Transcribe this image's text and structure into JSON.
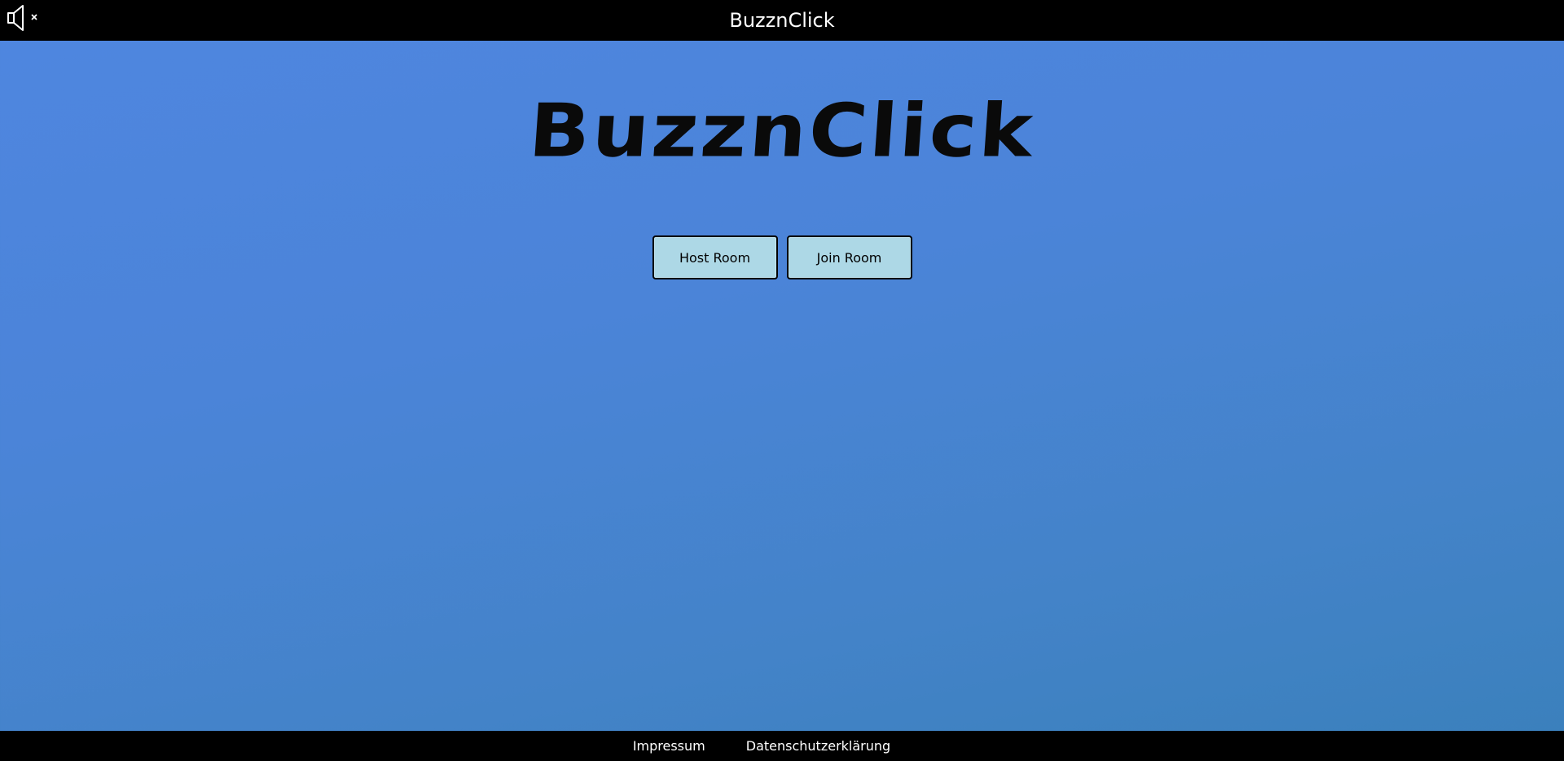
{
  "header": {
    "title": "BuzznClick",
    "mute_icon": "speaker-muted-icon"
  },
  "hero": {
    "title": "BuzznClick"
  },
  "actions": {
    "host_label": "Host Room",
    "join_label": "Join Room"
  },
  "footer": {
    "links": [
      {
        "label": "Impressum"
      },
      {
        "label": "Datenschutzerklärung"
      }
    ]
  },
  "colors": {
    "bar": "#000000",
    "background_top": "#4f86e0",
    "background_bottom": "#3a80bb",
    "button_fill": "#add8e6"
  }
}
